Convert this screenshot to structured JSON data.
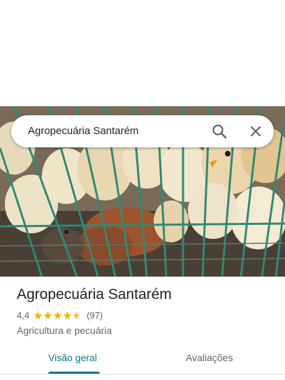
{
  "search": {
    "query": "Agropecuária Santarém"
  },
  "place": {
    "name": "Agropecuária Santarém",
    "rating": "4,4",
    "stars": 4.4,
    "review_count": "(97)",
    "category": "Agricultura e pecuária"
  },
  "tabs": [
    {
      "label": "Visão geral",
      "active": true
    },
    {
      "label": "Avaliações",
      "active": false
    }
  ],
  "colors": {
    "accent": "#0b7a83",
    "star": "#f5b400",
    "cage": "#2f8a74"
  },
  "icons": {
    "search": "search-icon",
    "close": "close-icon",
    "star": "star-icon"
  }
}
